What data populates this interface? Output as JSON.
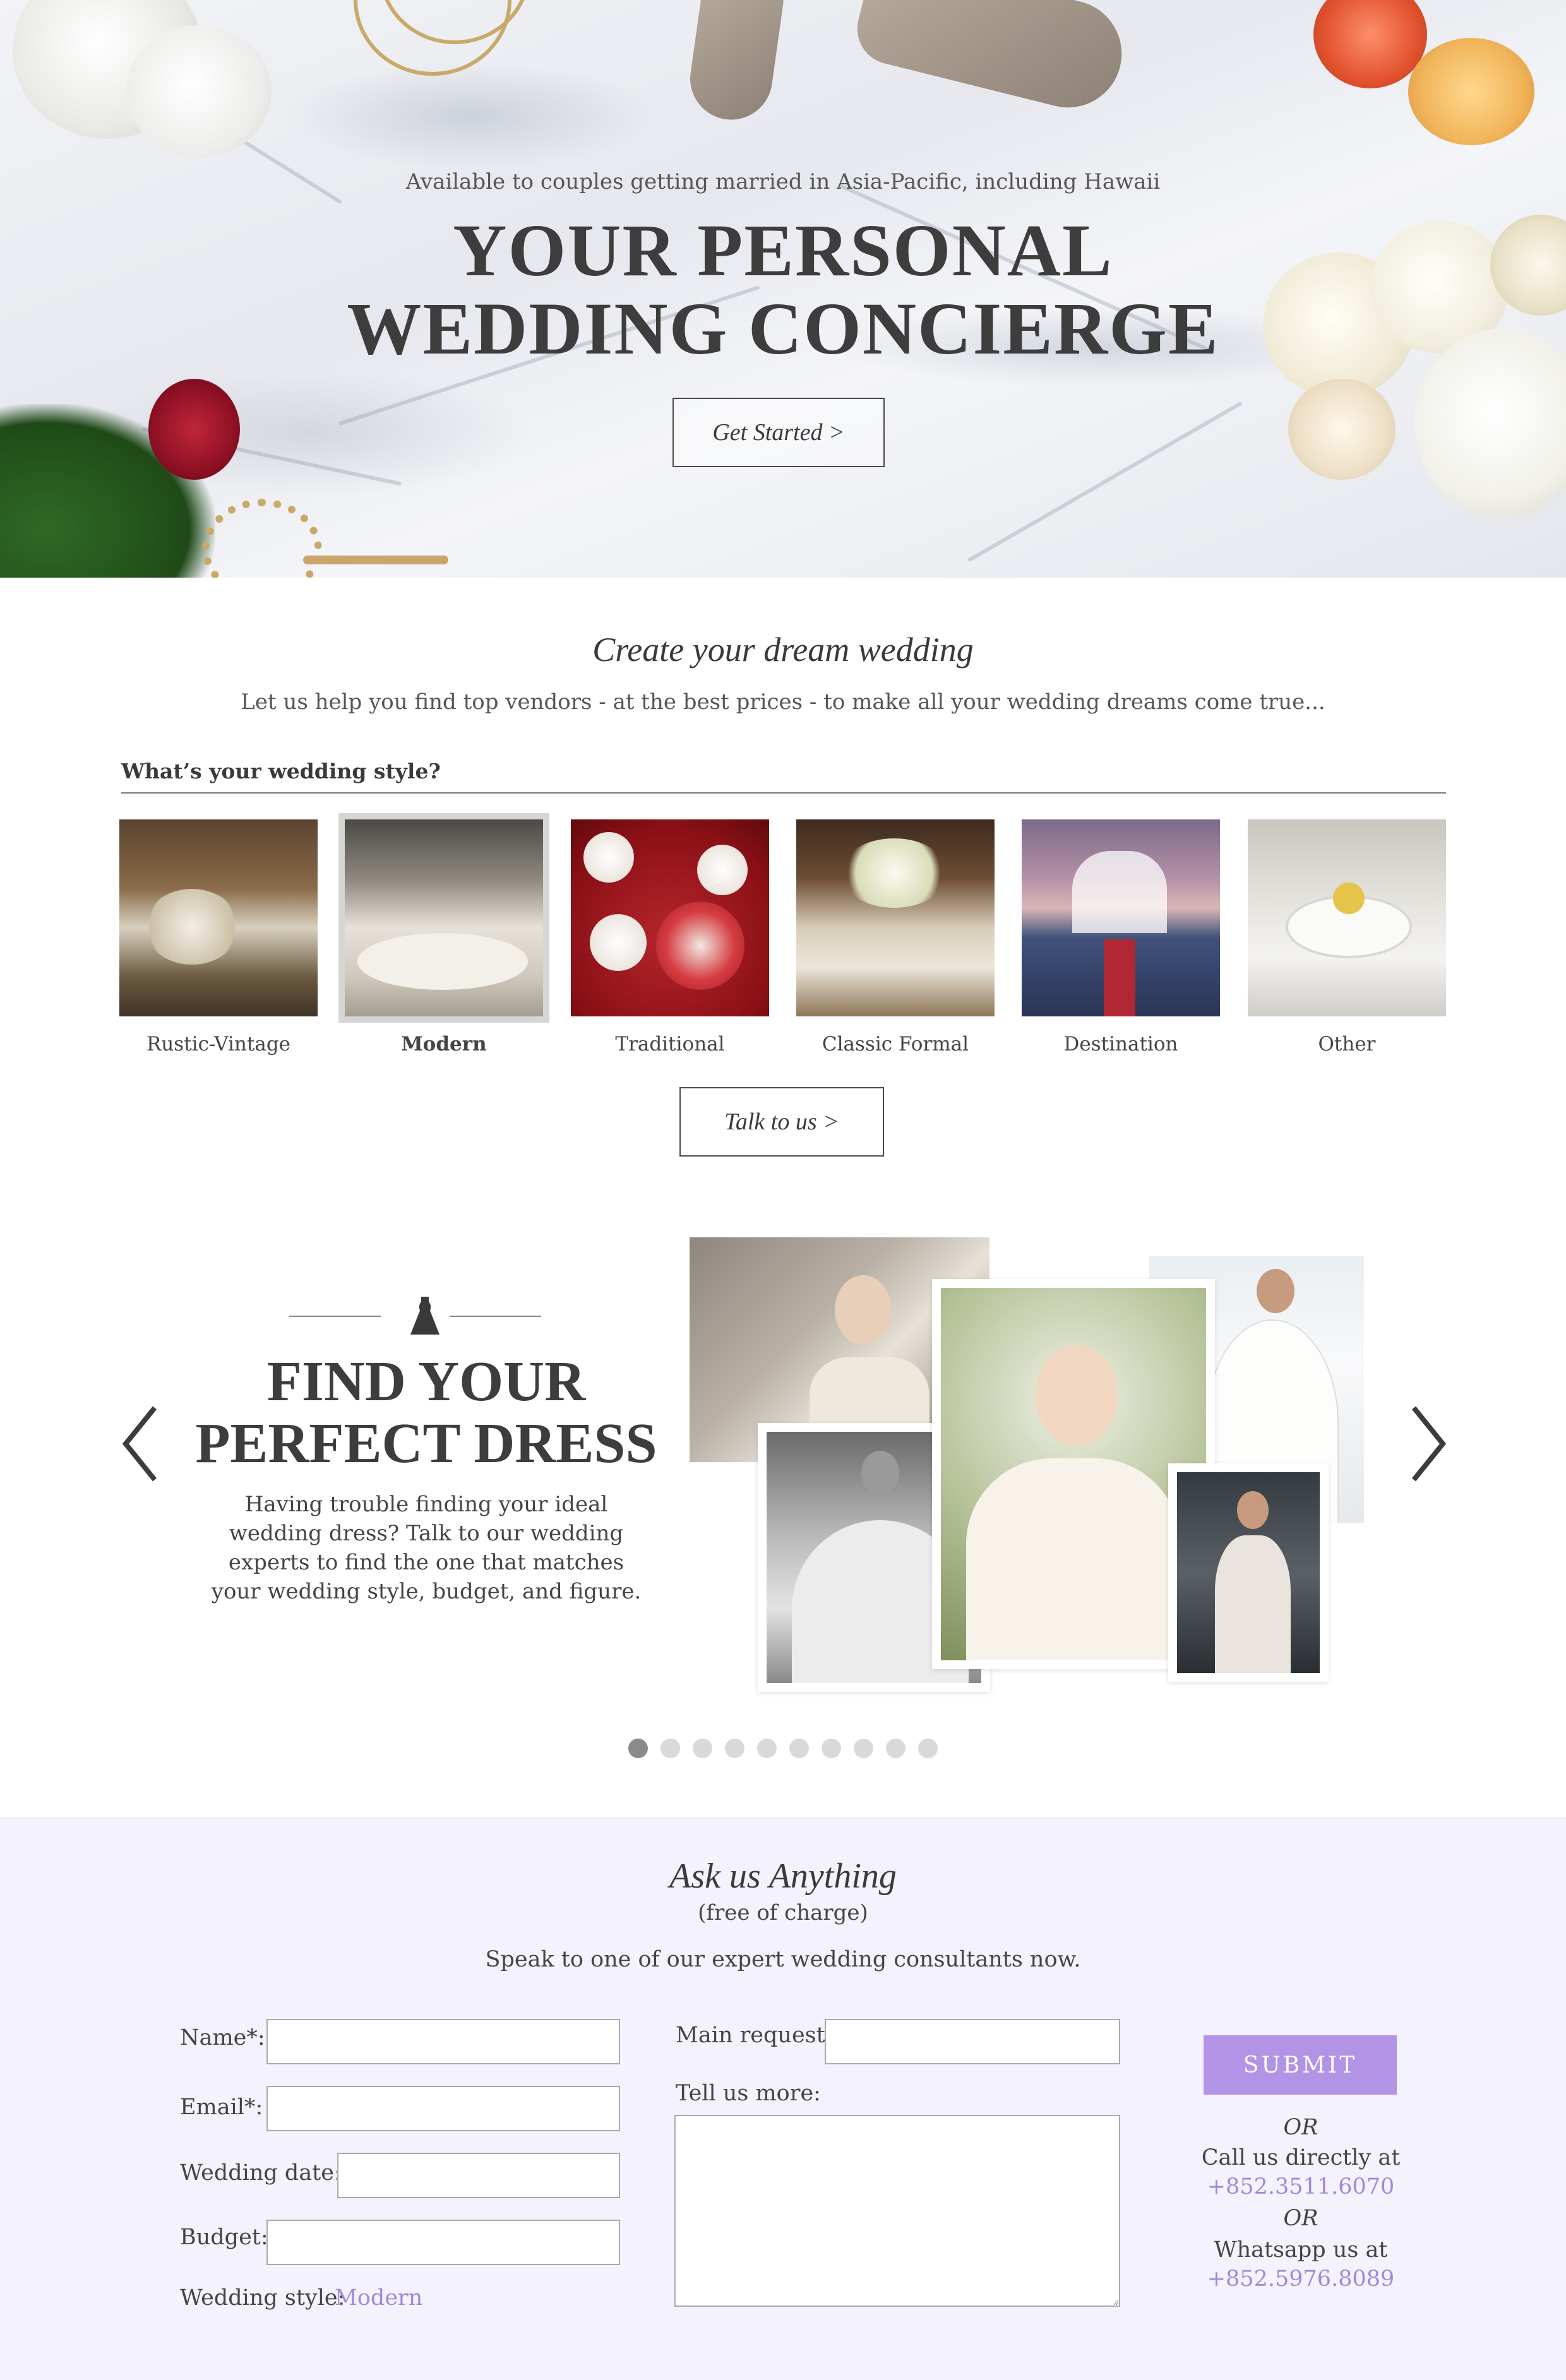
{
  "hero": {
    "subtitle": "Available to couples getting married in Asia-Pacific, including Hawaii",
    "title_line1": "YOUR PERSONAL",
    "title_line2": "WEDDING CONCIERGE",
    "cta_label": "Get Started  >"
  },
  "dream": {
    "title": "Create your dream wedding",
    "subtitle": "Let us help you find top vendors - at the best prices - to make all your wedding dreams come true...",
    "style_question": "What’s your wedding style?",
    "styles": [
      {
        "label": "Rustic-Vintage",
        "selected": false
      },
      {
        "label": "Modern",
        "selected": true
      },
      {
        "label": "Traditional",
        "selected": false
      },
      {
        "label": "Classic Formal",
        "selected": false
      },
      {
        "label": "Destination",
        "selected": false
      },
      {
        "label": "Other",
        "selected": false
      }
    ],
    "talk_label": "Talk to us  >"
  },
  "dress": {
    "title_line1": "FIND YOUR",
    "title_line2": "PERFECT DRESS",
    "text": "Having trouble finding your ideal wedding dress? Talk to our wedding experts to find the one that matches your wedding style, budget, and figure.",
    "slide_count": 10,
    "active_slide": 1
  },
  "ask": {
    "title": "Ask us Anything",
    "free": "(free of charge)",
    "speak": "Speak to one of our expert wedding consultants now.",
    "name_label": "Name*:",
    "email_label": "Email*:",
    "date_label": "Wedding date:",
    "budget_label": "Budget:",
    "style_label": "Wedding style:",
    "style_value": "Modern",
    "request_label": "Main request:",
    "more_label": "Tell us more:",
    "submit_label": "SUBMIT",
    "or1": "OR",
    "call_text": "Call us directly at",
    "call_phone": "+852.3511.6070",
    "or2": "OR",
    "whatsapp_text": "Whatsapp us at",
    "whatsapp_phone": "+852.5976.8089"
  },
  "colors": {
    "accent": "#b393e6",
    "link": "#a486d6",
    "form_bg": "#f4f2fd"
  }
}
